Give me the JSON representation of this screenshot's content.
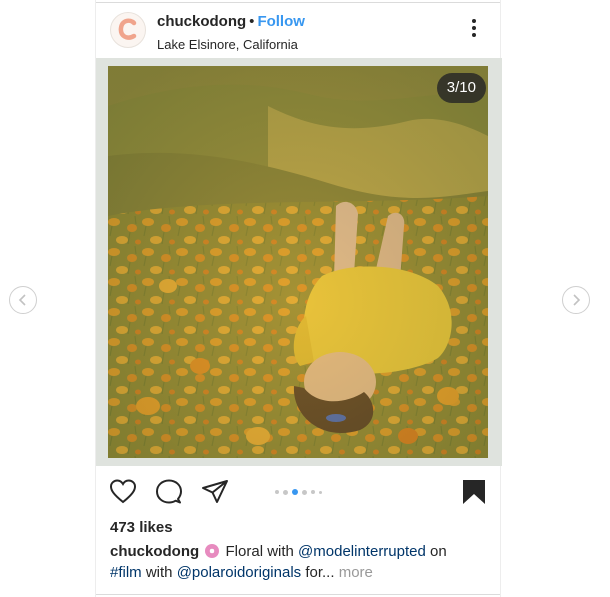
{
  "header": {
    "username": "chuckodong",
    "separator": "•",
    "follow_label": "Follow",
    "location": "Lake Elsinore, California"
  },
  "media": {
    "counter": "3/10",
    "current_slide": 3,
    "total_slides": 10
  },
  "actions": {
    "icons": [
      "heart-icon",
      "comment-icon",
      "share-icon",
      "bookmark-icon"
    ],
    "carousel_dots": 6,
    "active_dot": 3
  },
  "likes": "473 likes",
  "caption": {
    "username": "chuckodong",
    "text_1": "Floral with ",
    "mention_1": "@modelinterrupted",
    "text_2": " on",
    "hashtag": "#film",
    "text_3": " with ",
    "mention_2": "@polaroidoriginals",
    "text_4": " for",
    "ellipsis": "...",
    "more": " more"
  },
  "colors": {
    "link_blue": "#3897f0",
    "mention": "#003569",
    "active_dot": "#3897f0",
    "text": "#262626"
  }
}
